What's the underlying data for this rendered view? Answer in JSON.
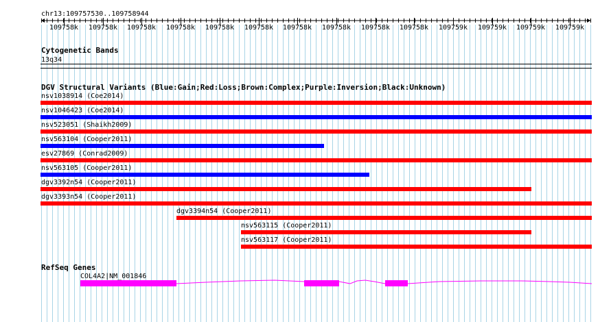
{
  "coords": "chr13:109757530..109758944",
  "ruler": {
    "ticks": [
      "109758k",
      "109758k",
      "109758k",
      "109758k",
      "109758k",
      "109758k",
      "109758k",
      "109758k",
      "109758k",
      "109758k",
      "109759k",
      "109759k",
      "109759k",
      "109759k"
    ]
  },
  "cytobands": {
    "title": "Cytogenetic Bands",
    "band": "13q34"
  },
  "dgv": {
    "title": "DGV Structural Variants (Blue:Gain;Red:Loss;Brown:Complex;Purple:Inversion;Black:Unknown)",
    "colors": {
      "gain": "#0000ff",
      "loss": "#ff0000"
    },
    "variants": [
      {
        "label": "nsv1038914 (Coe2014)",
        "type": "loss"
      },
      {
        "label": "nsv1046423 (Coe2014)",
        "type": "gain"
      },
      {
        "label": "nsv523051 (Shaikh2009)",
        "type": "loss"
      },
      {
        "label": "nsv563104 (Cooper2011)",
        "type": "gain"
      },
      {
        "label": "esv27869 (Conrad2009)",
        "type": "loss"
      },
      {
        "label": "nsv563105 (Cooper2011)",
        "type": "gain"
      },
      {
        "label": "dgv3392n54 (Cooper2011)",
        "type": "loss"
      },
      {
        "label": "dgv3393n54 (Cooper2011)",
        "type": "loss"
      },
      {
        "label": "dgv3394n54 (Cooper2011)",
        "type": "loss"
      },
      {
        "label": "nsv563115 (Cooper2011)",
        "type": "loss"
      },
      {
        "label": "nsv563117 (Cooper2011)",
        "type": "loss"
      }
    ]
  },
  "refseq": {
    "title": "RefSeq Genes",
    "gene_label": "COL4A2|NM_001846",
    "color": "#ff00ff"
  }
}
